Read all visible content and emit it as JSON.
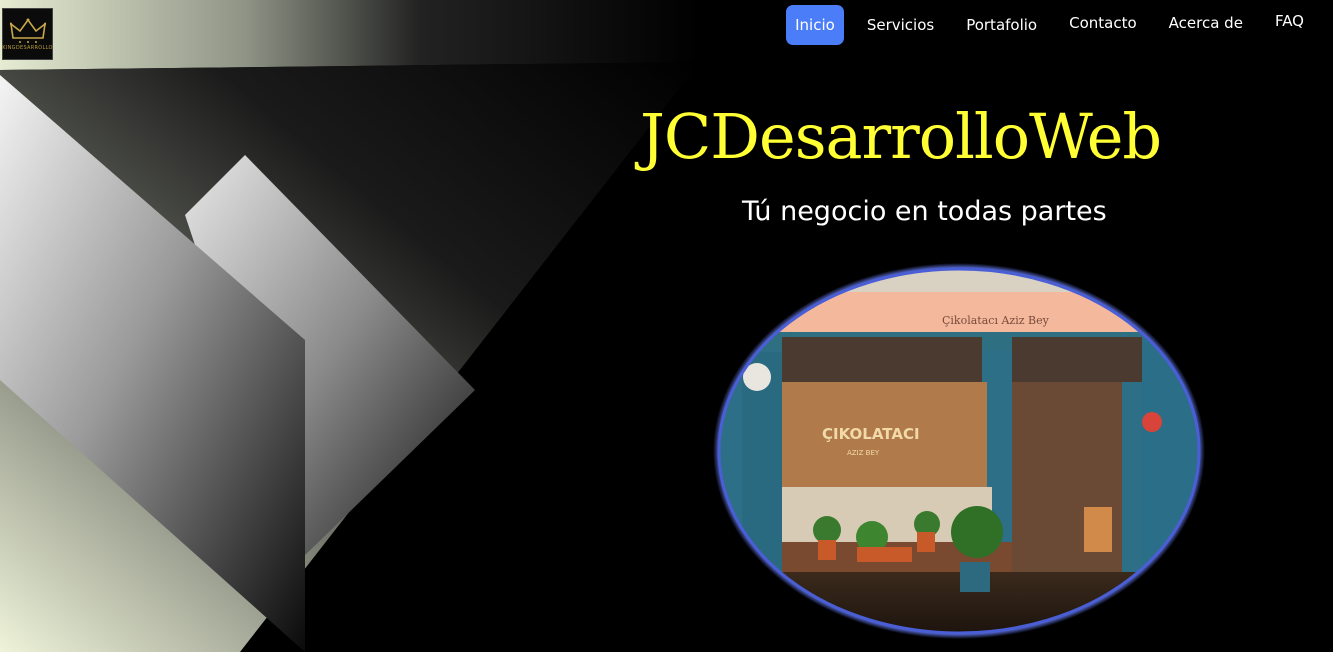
{
  "logo": {
    "text": "KINGDESARROLLO",
    "icon": "crown-icon"
  },
  "nav": [
    {
      "label": "Inicio",
      "active": true
    },
    {
      "label": "Servicios",
      "active": false
    },
    {
      "label": "Portafolio",
      "active": false
    },
    {
      "label": "Contacto",
      "active": false
    },
    {
      "label": "Acerca de",
      "active": false
    },
    {
      "label": "FAQ",
      "active": false
    }
  ],
  "hero": {
    "title": "JCDesarrolloWeb",
    "subtitle": "Tú negocio en todas partes",
    "photo_sign": "Çikolatacı Aziz Bey",
    "photo_window_text": "ÇIKOLATACI",
    "photo_window_sub": "AZIZ BEY"
  },
  "colors": {
    "accent": "#4a7df7",
    "title": "#ffff33",
    "background": "#000000"
  }
}
